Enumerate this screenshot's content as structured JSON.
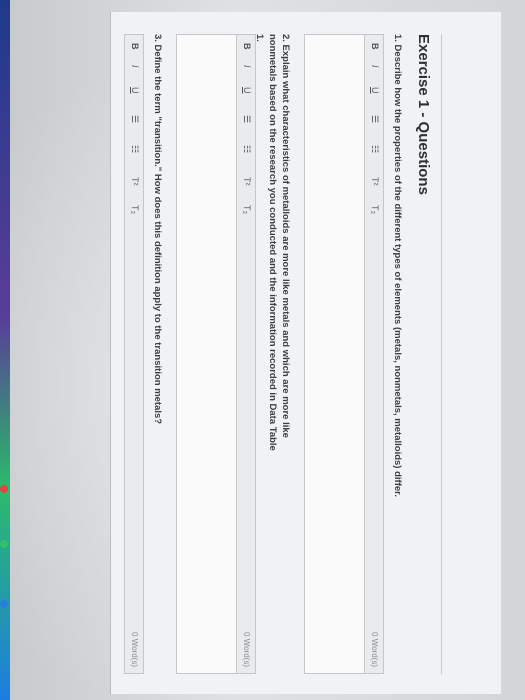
{
  "exercise_title": "Exercise 1 - Questions",
  "toolbar": {
    "bold": "B",
    "italic": "I",
    "underline": "U",
    "bullets": "☰",
    "numbered": "☷",
    "superscript": "T²",
    "subscript": "T₂"
  },
  "questions": [
    {
      "text": "1. Describe how the properties of the different types of elements (metals, nonmetals, metalloids) differ.",
      "word_count": "0 Word(s)"
    },
    {
      "text": "2. Explain what characteristics of metalloids are more like metals and which are more like nonmetals based on the research you conducted and the information recorded in Data Table 1.",
      "word_count": "0 Word(s)"
    },
    {
      "text": "3. Define the term \"transition.\" How does this definition apply to the transition metals?",
      "word_count": "0 Word(s)"
    }
  ],
  "colors": {
    "page_bg": "#cfd2d5",
    "sheet_bg": "#f1f2f3",
    "text": "#2d3035"
  }
}
